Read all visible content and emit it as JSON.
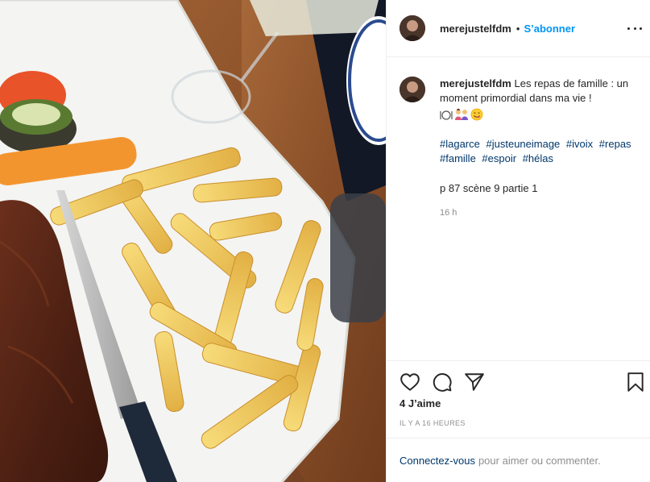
{
  "post": {
    "username": "merejustelfdm",
    "separator": "•",
    "follow_label": "S’abonner",
    "more_icon": "more-options-icon"
  },
  "caption": {
    "username": "merejustelfdm",
    "text": "Les repas de famille : un moment primordial dans ma vie !",
    "emojis": [
      "fork-knife-plate-emoji",
      "family-emoji",
      "yum-face-emoji"
    ],
    "hashtags": [
      "#lagarce",
      "#justeuneimage",
      "#ivoix",
      "#repas",
      "#famille",
      "#espoir",
      "#hélas"
    ],
    "scene_line": "p 87 scène 9 partie 1",
    "time_ago": "16 h"
  },
  "actions": {
    "icons": [
      "heart-icon",
      "comment-icon",
      "share-icon",
      "bookmark-icon"
    ],
    "likes": "4 J’aime",
    "posted": "IL Y A 16 HEURES"
  },
  "footer": {
    "login_link": "Connectez-vous",
    "rest_text": "pour aimer ou commenter."
  },
  "colors": {
    "link_blue": "#0095f6",
    "hashtag_blue": "#00376b",
    "muted": "#8e8e8e",
    "border": "#efefef"
  }
}
